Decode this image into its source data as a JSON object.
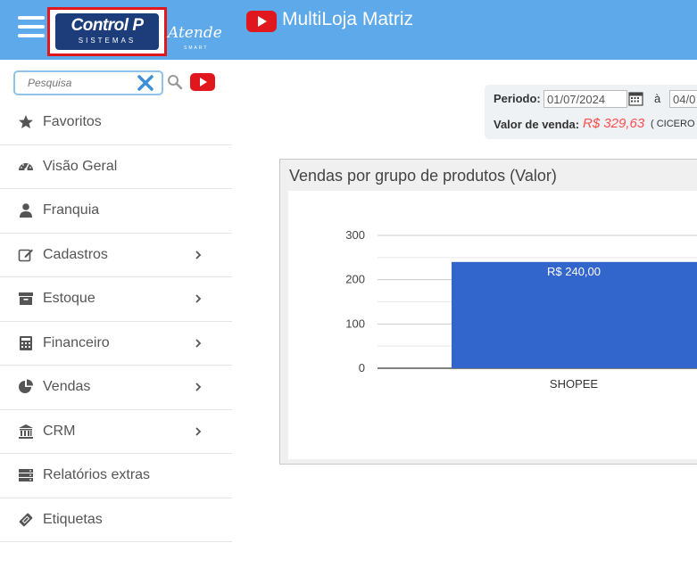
{
  "header": {
    "logo_main": "Control P",
    "logo_sub": "SISTEMAS",
    "atende_text": "Atende",
    "atende_sub": "SMART",
    "app_title": "MultiLoja Matriz"
  },
  "sidebar": {
    "search_placeholder": "Pesquisa",
    "items": [
      {
        "label": "Favoritos",
        "icon": "star-icon",
        "submenu": false
      },
      {
        "label": "Visão Geral",
        "icon": "dashboard-icon",
        "submenu": false
      },
      {
        "label": "Franquia",
        "icon": "user-icon",
        "submenu": false
      },
      {
        "label": "Cadastros",
        "icon": "edit-icon",
        "submenu": true
      },
      {
        "label": "Estoque",
        "icon": "archive-icon",
        "submenu": true
      },
      {
        "label": "Financeiro",
        "icon": "calculator-icon",
        "submenu": true
      },
      {
        "label": "Vendas",
        "icon": "pie-chart-icon",
        "submenu": true
      },
      {
        "label": "CRM",
        "icon": "bank-icon",
        "submenu": true
      },
      {
        "label": "Relatórios extras",
        "icon": "server-icon",
        "submenu": false
      },
      {
        "label": "Etiquetas",
        "icon": "ticket-icon",
        "submenu": false
      }
    ]
  },
  "filters": {
    "period_label": "Periodo:",
    "date_start": "01/07/2024",
    "date_separator": "à",
    "date_end": "04/0",
    "valor_label": "Valor de venda:",
    "valor_value": "R$ 329,63",
    "valor_extra": "( CICERO"
  },
  "panel": {
    "title": "Vendas por grupo de produtos (Valor)"
  },
  "chart_data": {
    "type": "bar",
    "title": "",
    "categories": [
      "SHOPEE"
    ],
    "values": [
      240
    ],
    "data_labels": [
      "R$ 240,00"
    ],
    "ylim": [
      0,
      300
    ],
    "yticks": [
      0,
      100,
      200,
      300
    ],
    "grid": true,
    "bar_color": "#3366cc"
  },
  "colors": {
    "header_bg": "#5da9e9",
    "accent_red": "#e1171e",
    "value_red": "#ff4d4d",
    "bar_blue": "#3366cc"
  }
}
